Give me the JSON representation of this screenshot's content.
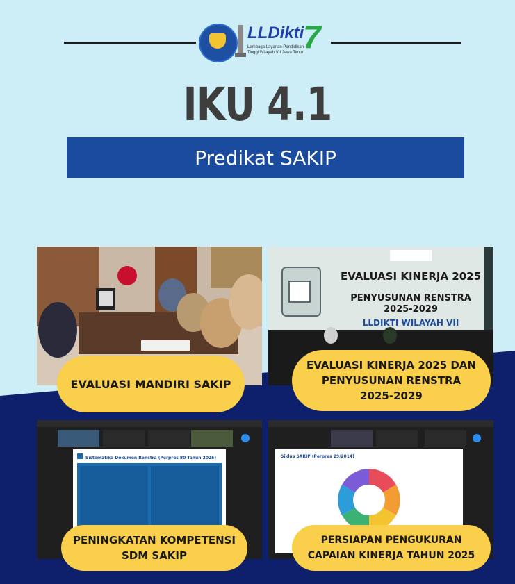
{
  "header": {
    "logo_name": "LLDikti",
    "logo_number": "7",
    "logo_subtitle": "Lembaga Layanan Pendidikan Tinggi Wilayah VII Jawa Timur"
  },
  "title": "IKU 4.1",
  "banner": "Predikat SAKIP",
  "cards": [
    {
      "label_lines": [
        "EVALUASI MANDIRI SAKIP"
      ]
    },
    {
      "label_lines": [
        "EVALUASI KINERJA 2025 DAN",
        "PENYUSUNAN RENSTRA",
        "2025-2029"
      ],
      "screen_title": "EVALUASI KINERJA 2025",
      "screen_sub": "PENYUSUNAN RENSTRA",
      "screen_years": "2025-2029",
      "screen_org": "LLDIKTI WILAYAH VII"
    },
    {
      "label_lines": [
        "PENINGKATAN KOMPETENSI",
        "SDM SAKIP"
      ],
      "slide_title": "Sistematika Dokumen Renstra (Perpres 80 Tahun 2025)"
    },
    {
      "label_lines": [
        "PERSIAPAN PENGUKURAN",
        "CAPAIAN KINERJA TAHUN 2025"
      ],
      "slide_title": "Siklus SAKIP (Perpres 29/2014)"
    }
  ],
  "colors": {
    "sky": "#cdeef7",
    "navy": "#0e1f6b",
    "banner": "#1a4b9e",
    "pill": "#f9cf4b",
    "title": "#3e3e3e"
  }
}
